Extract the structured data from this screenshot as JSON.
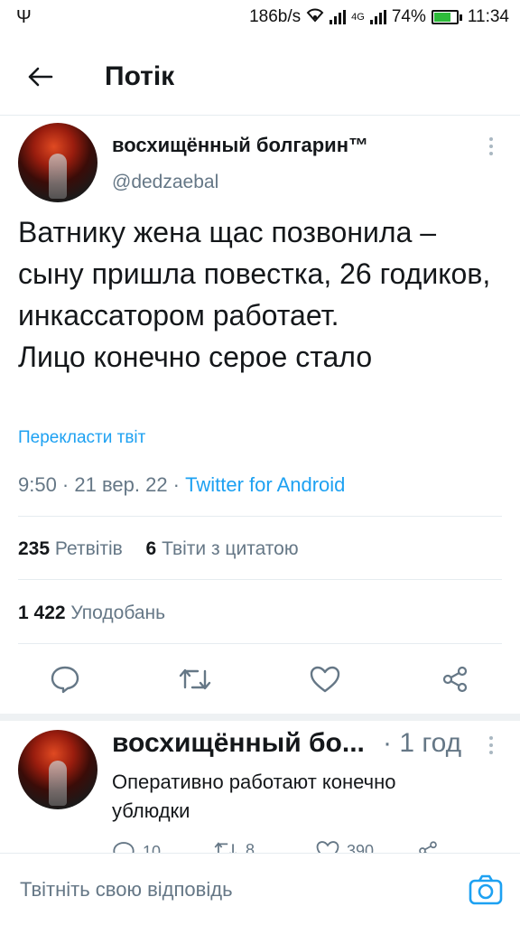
{
  "status_bar": {
    "usb_icon": "usb-icon",
    "speed": "186b/s",
    "network_type": "4G",
    "battery": "74%",
    "battery_level": 0.74,
    "time": "11:34"
  },
  "header": {
    "title": "Потік"
  },
  "tweet": {
    "author": "восхищённый болгарин™",
    "handle": "@dedzaebal",
    "text": "Ватнику жена щас позвонила – сыну пришла повестка, 26 годиков, инкассатором работает.\nЛицо конечно серое стало",
    "translate_label": "Перекласти твіт",
    "date": "9:50 · 21 вер. 22 · ",
    "source": "Twitter for Android",
    "retweets_count": "235",
    "retweets_label": "Ретвітів",
    "quotes_count": "6",
    "quotes_label": "Твіти з цитатою",
    "likes_count": "1 422",
    "likes_label": "Уподобань"
  },
  "reply": {
    "author": "восхищённый бо...",
    "time": "· 1 год",
    "text": "Оперативно работают конечно ублюдки",
    "replies": "10",
    "retweets": "8",
    "likes": "390"
  },
  "compose": {
    "placeholder": "Твітніть свою відповідь"
  },
  "colors": {
    "accent": "#1da1f2",
    "secondary_text": "#657786",
    "battery_fill": "#2dbb3a"
  }
}
